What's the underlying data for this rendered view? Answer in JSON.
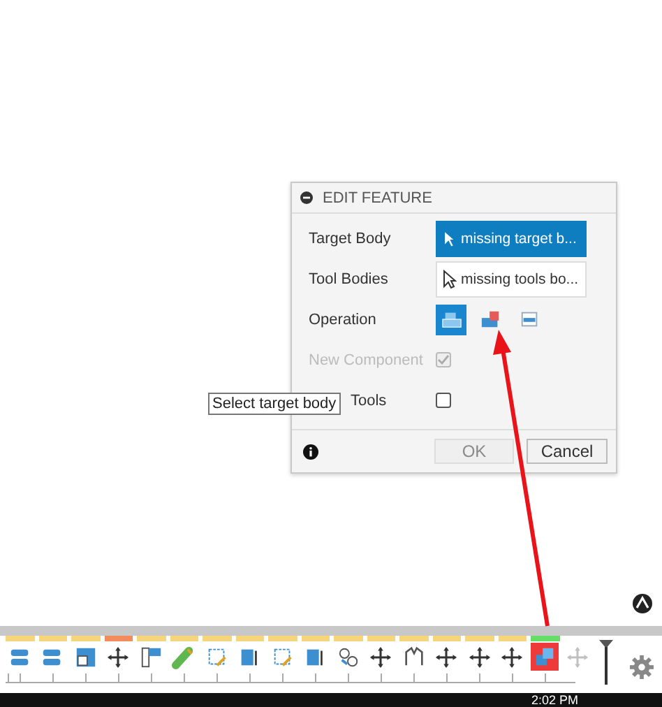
{
  "dialog": {
    "title": "EDIT FEATURE",
    "target_body": {
      "label": "Target Body",
      "value": "missing target b...",
      "active": true
    },
    "tool_bodies": {
      "label": "Tool Bodies",
      "value": "missing tools bo...",
      "active": false
    },
    "operation": {
      "label": "Operation",
      "options": [
        {
          "kind": "join",
          "selected": true
        },
        {
          "kind": "cut",
          "selected": false
        },
        {
          "kind": "intersect",
          "selected": false
        }
      ]
    },
    "new_component": {
      "label": "New Component",
      "checked": true,
      "disabled": true
    },
    "keep_tools": {
      "label": "Tools",
      "checked": false,
      "disabled": false
    },
    "ok": {
      "label": "OK",
      "disabled": true
    },
    "cancel": {
      "label": "Cancel",
      "disabled": false
    }
  },
  "tooltip": "Select target body",
  "timeline": {
    "items": [
      {
        "kind": "body",
        "color": "#f7d57a",
        "selected": false,
        "disabled": false
      },
      {
        "kind": "body",
        "color": "#f7d57a",
        "selected": false,
        "disabled": false
      },
      {
        "kind": "box",
        "color": "#f7d57a",
        "selected": false,
        "disabled": false
      },
      {
        "kind": "move",
        "color": "#f28c5a",
        "selected": false,
        "disabled": false
      },
      {
        "kind": "bracket",
        "color": "#f7d57a",
        "selected": false,
        "disabled": false
      },
      {
        "kind": "pipe",
        "color": "#f7d57a",
        "selected": false,
        "disabled": false
      },
      {
        "kind": "sketch",
        "color": "#f7d57a",
        "selected": false,
        "disabled": false
      },
      {
        "kind": "solid",
        "color": "#f7d57a",
        "selected": false,
        "disabled": false
      },
      {
        "kind": "sketch",
        "color": "#f7d57a",
        "selected": false,
        "disabled": false
      },
      {
        "kind": "solid",
        "color": "#f7d57a",
        "selected": false,
        "disabled": false
      },
      {
        "kind": "joint",
        "color": "#f7d57a",
        "selected": false,
        "disabled": false
      },
      {
        "kind": "move",
        "color": "#f7d57a",
        "selected": false,
        "disabled": false
      },
      {
        "kind": "mirror",
        "color": "#f7d57a",
        "selected": false,
        "disabled": false
      },
      {
        "kind": "move",
        "color": "#f7d57a",
        "selected": false,
        "disabled": false
      },
      {
        "kind": "move",
        "color": "#f7d57a",
        "selected": false,
        "disabled": false
      },
      {
        "kind": "move",
        "color": "#f7d57a",
        "selected": false,
        "disabled": false
      },
      {
        "kind": "combine",
        "color": "#66dd66",
        "selected": true,
        "disabled": false
      },
      {
        "kind": "move",
        "selected": false,
        "disabled": true
      }
    ]
  },
  "clock": "2:02 PM"
}
